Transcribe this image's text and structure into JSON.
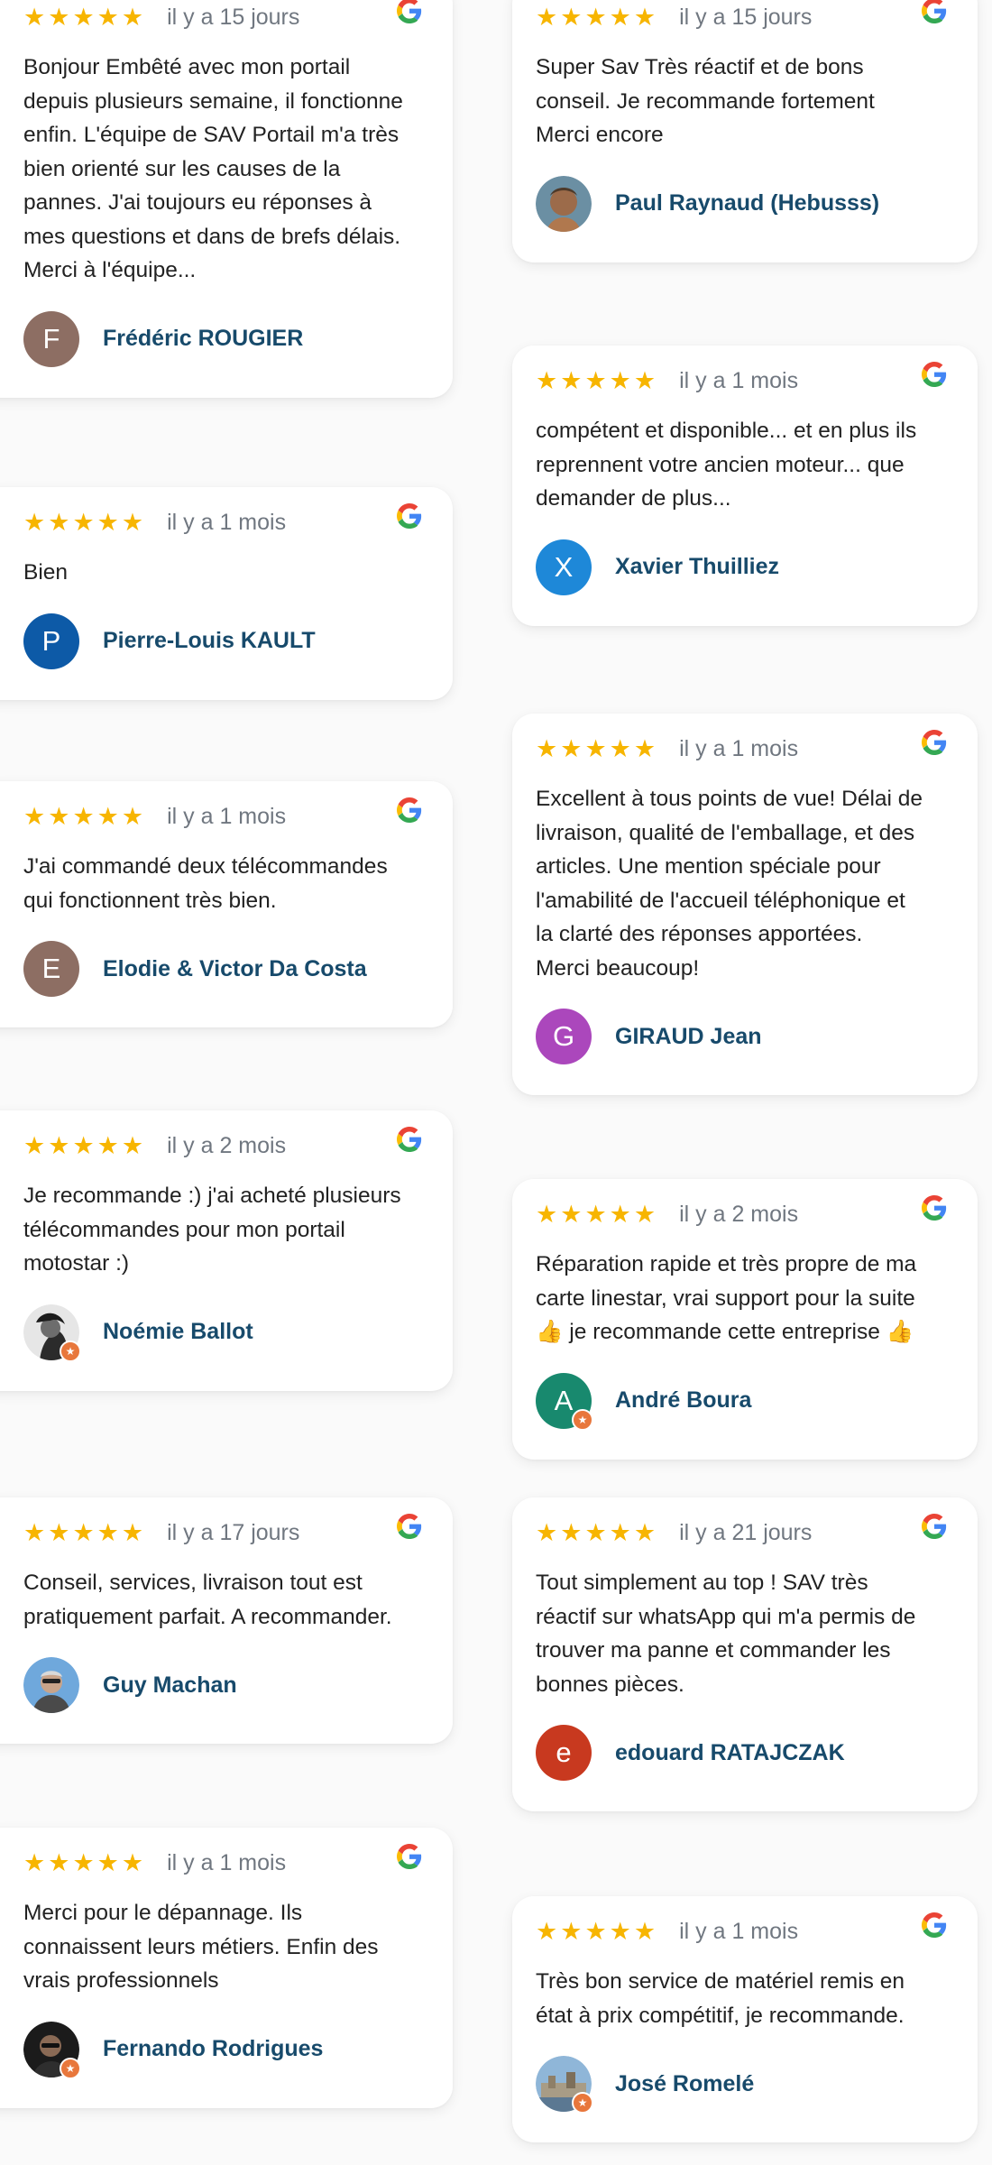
{
  "rating_icon": "star-icon",
  "source_icon": "google-icon",
  "colors": {
    "star": "#f7b500",
    "author_name": "#174a6b",
    "date": "#707780",
    "local_guide_badge": "#e8773c"
  },
  "reviews_left": [
    {
      "rating": 5,
      "date": "il y a 15 jours",
      "text": "Bonjour Embêté avec mon portail\ndepuis plusieurs semaine, il fonctionne\nenfin. L'équipe de SAV Portail m'a très\nbien orienté sur les causes de la\npannes. J'ai toujours eu réponses à\nmes questions et dans de brefs délais.\nMerci à l'équipe...",
      "author": "Frédéric ROUGIER",
      "initial": "F",
      "avatar_color": "#8d6e63",
      "avatar_type": "initial"
    },
    {
      "rating": 5,
      "date": "il y a 1 mois",
      "text": "Bien",
      "author": "Pierre-Louis KAULT",
      "initial": "P",
      "avatar_color": "#0d5aa7",
      "avatar_type": "initial"
    },
    {
      "rating": 5,
      "date": "il y a 1 mois",
      "text": "J'ai commandé deux télécommandes\nqui fonctionnent très bien.",
      "author": "Elodie & Victor Da Costa",
      "initial": "E",
      "avatar_color": "#8d6e63",
      "avatar_type": "initial"
    },
    {
      "rating": 5,
      "date": "il y a 2 mois",
      "text": "Je recommande :) j'ai acheté plusieurs\ntélécommandes pour mon portail\nmotostar :)",
      "author": "Noémie Ballot",
      "avatar_type": "photo-bw",
      "local_guide": true
    },
    {
      "rating": 5,
      "date": "il y a 17 jours",
      "text": "Conseil, services, livraison tout est\npratiquement parfait. A recommander.",
      "author": "Guy Machan",
      "avatar_type": "photo-blue"
    },
    {
      "rating": 5,
      "date": "il y a 1 mois",
      "text": "Merci pour le dépannage. Ils\nconnaissent leurs métiers. Enfin des\nvrais professionnels",
      "author": "Fernando Rodrigues",
      "avatar_type": "photo-dark",
      "local_guide": true
    }
  ],
  "reviews_right": [
    {
      "rating": 5,
      "date": "il y a 15 jours",
      "text": "Super Sav Très réactif et de bons\nconseil. Je recommande fortement\nMerci encore",
      "author": "Paul Raynaud (Hebusss)",
      "avatar_type": "photo-teal"
    },
    {
      "rating": 5,
      "date": "il y a 1 mois",
      "text": "compétent et disponible... et en plus ils\nreprennent votre ancien moteur... que\ndemander de plus...",
      "author": "Xavier Thuilliez",
      "initial": "X",
      "avatar_color": "#1e88d8",
      "avatar_type": "initial"
    },
    {
      "rating": 5,
      "date": "il y a 1 mois",
      "text": "Excellent à tous points de vue! Délai de\nlivraison, qualité de l'emballage, et des\narticles. Une mention spéciale pour\nl'amabilité de l'accueil téléphonique et\nla clarté des réponses apportées.\nMerci beaucoup!",
      "author": "GIRAUD Jean",
      "initial": "G",
      "avatar_color": "#ab47bc",
      "avatar_type": "initial"
    },
    {
      "rating": 5,
      "date": "il y a 2 mois",
      "text": "Réparation rapide et très propre de ma\ncarte linestar, vrai support pour la suite\n👍 je recommande cette entreprise 👍",
      "author": "André Boura",
      "initial": "A",
      "avatar_color": "#18896e",
      "avatar_type": "initial",
      "local_guide": true
    },
    {
      "rating": 5,
      "date": "il y a 21 jours",
      "text": "Tout simplement au top ! SAV très\nréactif sur whatsApp qui m'a permis de\ntrouver ma panne et commander les\nbonnes pièces.",
      "author": "edouard RATAJCZAK",
      "initial": "e",
      "avatar_color": "#c8391f",
      "avatar_type": "initial"
    },
    {
      "rating": 5,
      "date": "il y a 1 mois",
      "text": "Très bon service de matériel remis en\nétat à prix compétitif, je recommande.",
      "author": "José Romelé",
      "avatar_type": "photo-city",
      "local_guide": true
    }
  ]
}
